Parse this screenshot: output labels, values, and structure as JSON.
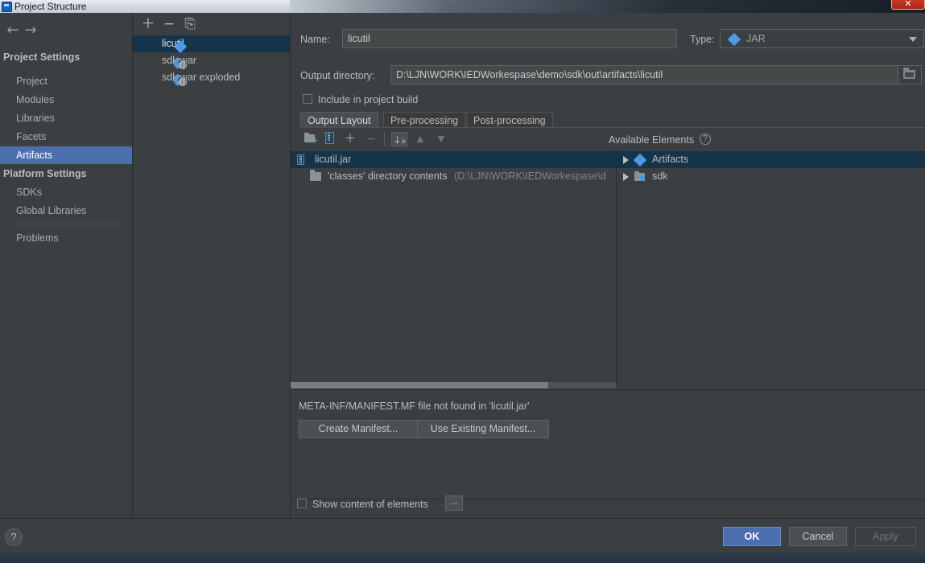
{
  "window": {
    "title": "Project Structure",
    "close_label": "✕",
    "title_icon": "app-icon"
  },
  "sidebar": {
    "nav": {
      "back_icon": "←",
      "forward_icon": "→"
    },
    "groups": [
      {
        "label": "Project Settings",
        "items": [
          {
            "label": "Project",
            "selected": false
          },
          {
            "label": "Modules",
            "selected": false
          },
          {
            "label": "Libraries",
            "selected": false
          },
          {
            "label": "Facets",
            "selected": false
          },
          {
            "label": "Artifacts",
            "selected": true
          }
        ]
      },
      {
        "label": "Platform Settings",
        "items": [
          {
            "label": "SDKs",
            "selected": false
          },
          {
            "label": "Global Libraries",
            "selected": false
          }
        ]
      }
    ],
    "problems": {
      "label": "Problems"
    }
  },
  "artifact_list": {
    "toolbar": [
      {
        "name": "add-artifact-button",
        "glyph": "＋"
      },
      {
        "name": "remove-artifact-button",
        "glyph": "−"
      },
      {
        "name": "copy-artifact-button",
        "glyph": "⎘"
      }
    ],
    "items": [
      {
        "label": "licutil",
        "icon": "jar-artifact-icon",
        "selected": true
      },
      {
        "label": "sdk:war",
        "icon": "war-artifact-icon",
        "selected": false
      },
      {
        "label": "sdk:war exploded",
        "icon": "war-exploded-artifact-icon",
        "selected": false
      }
    ]
  },
  "main": {
    "name_label": "Name:",
    "name_value": "licutil",
    "type_label": "Type:",
    "type_value": "JAR",
    "output_dir_label": "Output directory:",
    "output_dir_value": "D:\\LJN\\WORK\\IEDWorkespase\\demo\\sdk\\out\\artifacts\\licutil",
    "include_in_build_label": "Include in project build",
    "include_in_build_checked": false,
    "tabs": [
      {
        "label": "Output Layout",
        "active": true
      },
      {
        "label": "Pre-processing",
        "active": false
      },
      {
        "label": "Post-processing",
        "active": false
      }
    ],
    "layout_toolbar": [
      {
        "name": "add-directory-button",
        "glyph": "📁"
      },
      {
        "name": "add-archive-button",
        "glyph": "▮"
      },
      {
        "name": "add-copy-button",
        "glyph": "＋"
      },
      {
        "name": "remove-element-button",
        "glyph": "−"
      },
      {
        "name": "sort-button",
        "glyph": "↓"
      },
      {
        "name": "move-up-button",
        "glyph": "▲"
      },
      {
        "name": "move-down-button",
        "glyph": "▼"
      }
    ],
    "layout_tree": [
      {
        "label": "licutil.jar",
        "detail": "",
        "icon": "archive-icon",
        "indent": 0,
        "selected": true
      },
      {
        "label": "'classes' directory contents",
        "detail": "(D:\\LJN\\WORK\\IEDWorkespase\\d",
        "icon": "folder-icon",
        "indent": 1,
        "selected": false
      }
    ],
    "available_elements_label": "Available Elements",
    "available_help_icon": "?",
    "available_tree": [
      {
        "label": "Artifacts",
        "icon": "jar-artifact-icon",
        "expandable": true,
        "selected": true
      },
      {
        "label": "sdk",
        "icon": "module-icon",
        "expandable": true,
        "selected": false
      }
    ],
    "manifest_message": "META-INF/MANIFEST.MF file not found in 'licutil.jar'",
    "create_manifest_button": "Create Manifest...",
    "use_existing_manifest_button": "Use Existing Manifest...",
    "show_content_label": "Show content of elements",
    "show_content_checked": false,
    "show_content_more_button": "..."
  },
  "footer": {
    "help_label": "?",
    "ok_label": "OK",
    "cancel_label": "Cancel",
    "apply_label": "Apply"
  },
  "annotation": {
    "arrow_color": "#f23b2c",
    "name": "red-arrow-annotation"
  }
}
